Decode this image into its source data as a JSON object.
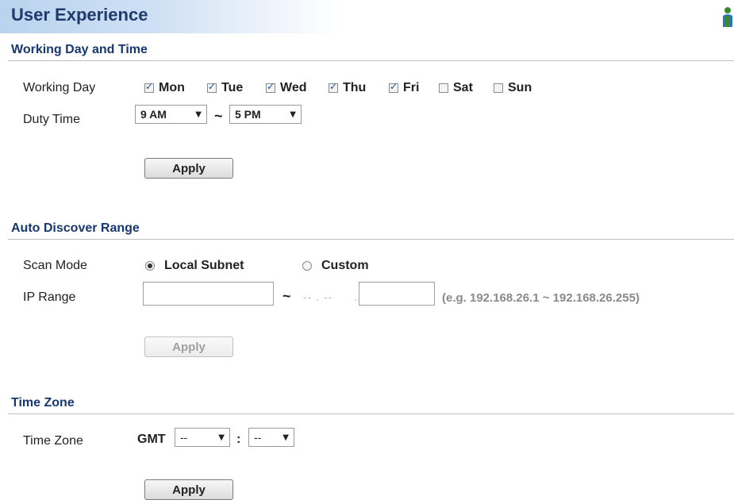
{
  "page": {
    "title": "User Experience",
    "user_icon": "user-icon"
  },
  "working": {
    "section_title": "Working Day and Time",
    "day_label": "Working Day",
    "days": [
      {
        "label": "Mon",
        "checked": true
      },
      {
        "label": "Tue",
        "checked": true
      },
      {
        "label": "Wed",
        "checked": true
      },
      {
        "label": "Thu",
        "checked": true
      },
      {
        "label": "Fri",
        "checked": true
      },
      {
        "label": "Sat",
        "checked": false
      },
      {
        "label": "Sun",
        "checked": false
      }
    ],
    "duty_label": "Duty Time",
    "start_time": "9 AM",
    "separator": "~",
    "end_time": "5 PM",
    "apply_label": "Apply"
  },
  "discover": {
    "section_title": "Auto Discover Range",
    "scan_label": "Scan Mode",
    "modes": [
      {
        "label": "Local Subnet",
        "selected": true
      },
      {
        "label": "Custom",
        "selected": false
      }
    ],
    "ip_label": "IP Range",
    "ip_start": "",
    "separator": "~",
    "ip_mid": "-- . --",
    "ip_dot": ".",
    "ip_end": "",
    "hint": "(e.g. 192.168.26.1 ~ 192.168.26.255)",
    "apply_label": "Apply",
    "apply_enabled": false
  },
  "timezone": {
    "section_title": "Time Zone",
    "label": "Time Zone",
    "gmt_label": "GMT",
    "hours": "--",
    "colon": ":",
    "minutes": "--",
    "apply_label": "Apply"
  },
  "colors": {
    "title_text": "#1f3a6b",
    "section_text": "#17386e",
    "title_gradient_start": "#b9d3ee",
    "disabled_text": "#a0a0a0",
    "hint_text": "#8a8a8a"
  }
}
